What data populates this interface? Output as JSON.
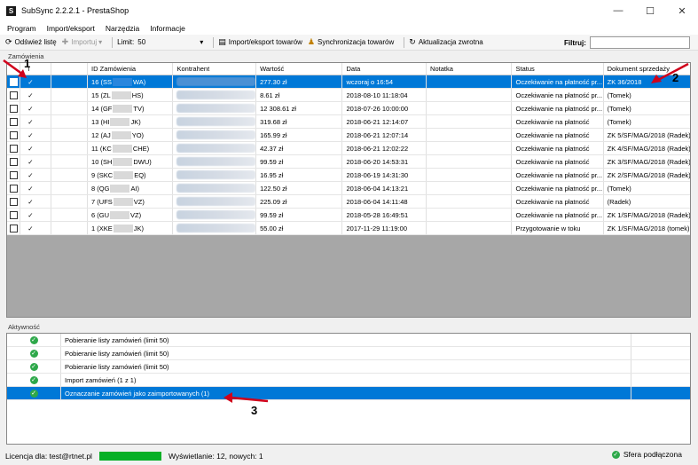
{
  "window": {
    "title": "SubSync 2.2.2.1 - PrestaShop",
    "app_icon": "S",
    "controls": {
      "minimize": "—",
      "maximize": "☐",
      "close": "✕"
    }
  },
  "menu": [
    "Program",
    "Import/eksport",
    "Narzędzia",
    "Informacje"
  ],
  "toolbar": {
    "refresh": "Odśwież listę",
    "import": "Importuj",
    "limit_label": "Limit:",
    "limit_value": "50",
    "import_export_products": "Import/eksport towarów",
    "sync_products": "Synchronizacja towarów",
    "reverse_update": "Aktualizacja zwrotna",
    "filter_label": "Filtruj:",
    "filter_value": ""
  },
  "orders_section_label": "Zamówienia",
  "orders_table": {
    "headers": [
      "",
      "I",
      "ID Zamówienia",
      "Kontrahent",
      "Wartość",
      "Data",
      "Notatka",
      "Status",
      "Dokument sprzedaży"
    ],
    "rows": [
      {
        "check": "✓",
        "id_num": "16 (SS",
        "id_tail": "WA)",
        "value": "277.30 zł",
        "date": "wczoraj o 16:54",
        "note": "",
        "status": "Oczekiwanie na płatność pr...",
        "doc": "ZK 36/2018",
        "selected": true
      },
      {
        "check": "✓",
        "id_num": "15 (ZL",
        "id_tail": "HS)",
        "value": "8.61 zł",
        "date": "2018-08-10 11:18:04",
        "note": "",
        "status": "Oczekiwanie na płatność pr...",
        "doc": "(Tomek)"
      },
      {
        "check": "✓",
        "id_num": "14 (GF",
        "id_tail": "TV)",
        "value": "12 308.61 zł",
        "date": "2018-07-26 10:00:00",
        "note": "",
        "status": "Oczekiwanie na płatność pr...",
        "doc": "(Tomek)"
      },
      {
        "check": "✓",
        "id_num": "13 (HI",
        "id_tail": "JK)",
        "value": "319.68 zł",
        "date": "2018-06-21 12:14:07",
        "note": "",
        "status": "Oczekiwanie na płatność",
        "doc": "(Tomek)"
      },
      {
        "check": "✓",
        "id_num": "12 (AJ",
        "id_tail": "YO)",
        "value": "165.99 zł",
        "date": "2018-06-21 12:07:14",
        "note": "",
        "status": "Oczekiwanie na płatność",
        "doc": "ZK 5/SF/MAG/2018 (Radek)"
      },
      {
        "check": "✓",
        "id_num": "11 (KC",
        "id_tail": "CHE)",
        "value": "42.37 zł",
        "date": "2018-06-21 12:02:22",
        "note": "",
        "status": "Oczekiwanie na płatność",
        "doc": "ZK 4/SF/MAG/2018 (Radek)"
      },
      {
        "check": "✓",
        "id_num": "10 (SH",
        "id_tail": "DWU)",
        "value": "99.59 zł",
        "date": "2018-06-20 14:53:31",
        "note": "",
        "status": "Oczekiwanie na płatność",
        "doc": "ZK 3/SF/MAG/2018 (Radek)"
      },
      {
        "check": "✓",
        "id_num": "9 (SKC",
        "id_tail": "EQ)",
        "value": "16.95 zł",
        "date": "2018-06-19 14:31:30",
        "note": "",
        "status": "Oczekiwanie na płatność pr...",
        "doc": "ZK 2/SF/MAG/2018 (Radek)"
      },
      {
        "check": "✓",
        "id_num": "8 (QG",
        "id_tail": "AI)",
        "value": "122.50 zł",
        "date": "2018-06-04 14:13:21",
        "note": "",
        "status": "Oczekiwanie na płatność pr...",
        "doc": "(Tomek)"
      },
      {
        "check": "✓",
        "id_num": "7 (UFS",
        "id_tail": "VZ)",
        "value": "225.09 zł",
        "date": "2018-06-04 14:11:48",
        "note": "",
        "status": "Oczekiwanie na płatność",
        "doc": "(Radek)"
      },
      {
        "check": "✓",
        "id_num": "6 (GU",
        "id_tail": "VZ)",
        "value": "99.59 zł",
        "date": "2018-05-28 16:49:51",
        "note": "",
        "status": "Oczekiwanie na płatność pr...",
        "doc": "ZK 1/SF/MAG/2018 (Radek)"
      },
      {
        "check": "✓",
        "id_num": "1 (XKE",
        "id_tail": "JK)",
        "value": "55.00 zł",
        "date": "2017-11-29 11:19:00",
        "note": "",
        "status": "Przygotowanie w toku",
        "doc": "ZK 1/SF/MAG/2018 (tomek)"
      }
    ]
  },
  "activity_section_label": "Aktywność",
  "activity": [
    {
      "text": "Pobieranie listy zamówień (limit 50)"
    },
    {
      "text": "Pobieranie listy zamówień (limit 50)"
    },
    {
      "text": "Pobieranie listy zamówień (limit 50)"
    },
    {
      "text": "Import zamówień (1 z 1)"
    },
    {
      "text": "Oznaczanie zamówień jako zaimportowanych (1)",
      "selected": true
    }
  ],
  "status": {
    "license": "Licencja dla: test@rtnet.pl",
    "progress": 1.0,
    "display": "Wyświetlanie: 12, nowych: 1",
    "sphere": "Sfera podłączona"
  },
  "annotations": [
    "1",
    "2",
    "3"
  ],
  "colors": {
    "selection": "#0078d7",
    "progress": "#06b025",
    "ok": "#2ea84a",
    "arrow": "#d0021b"
  }
}
